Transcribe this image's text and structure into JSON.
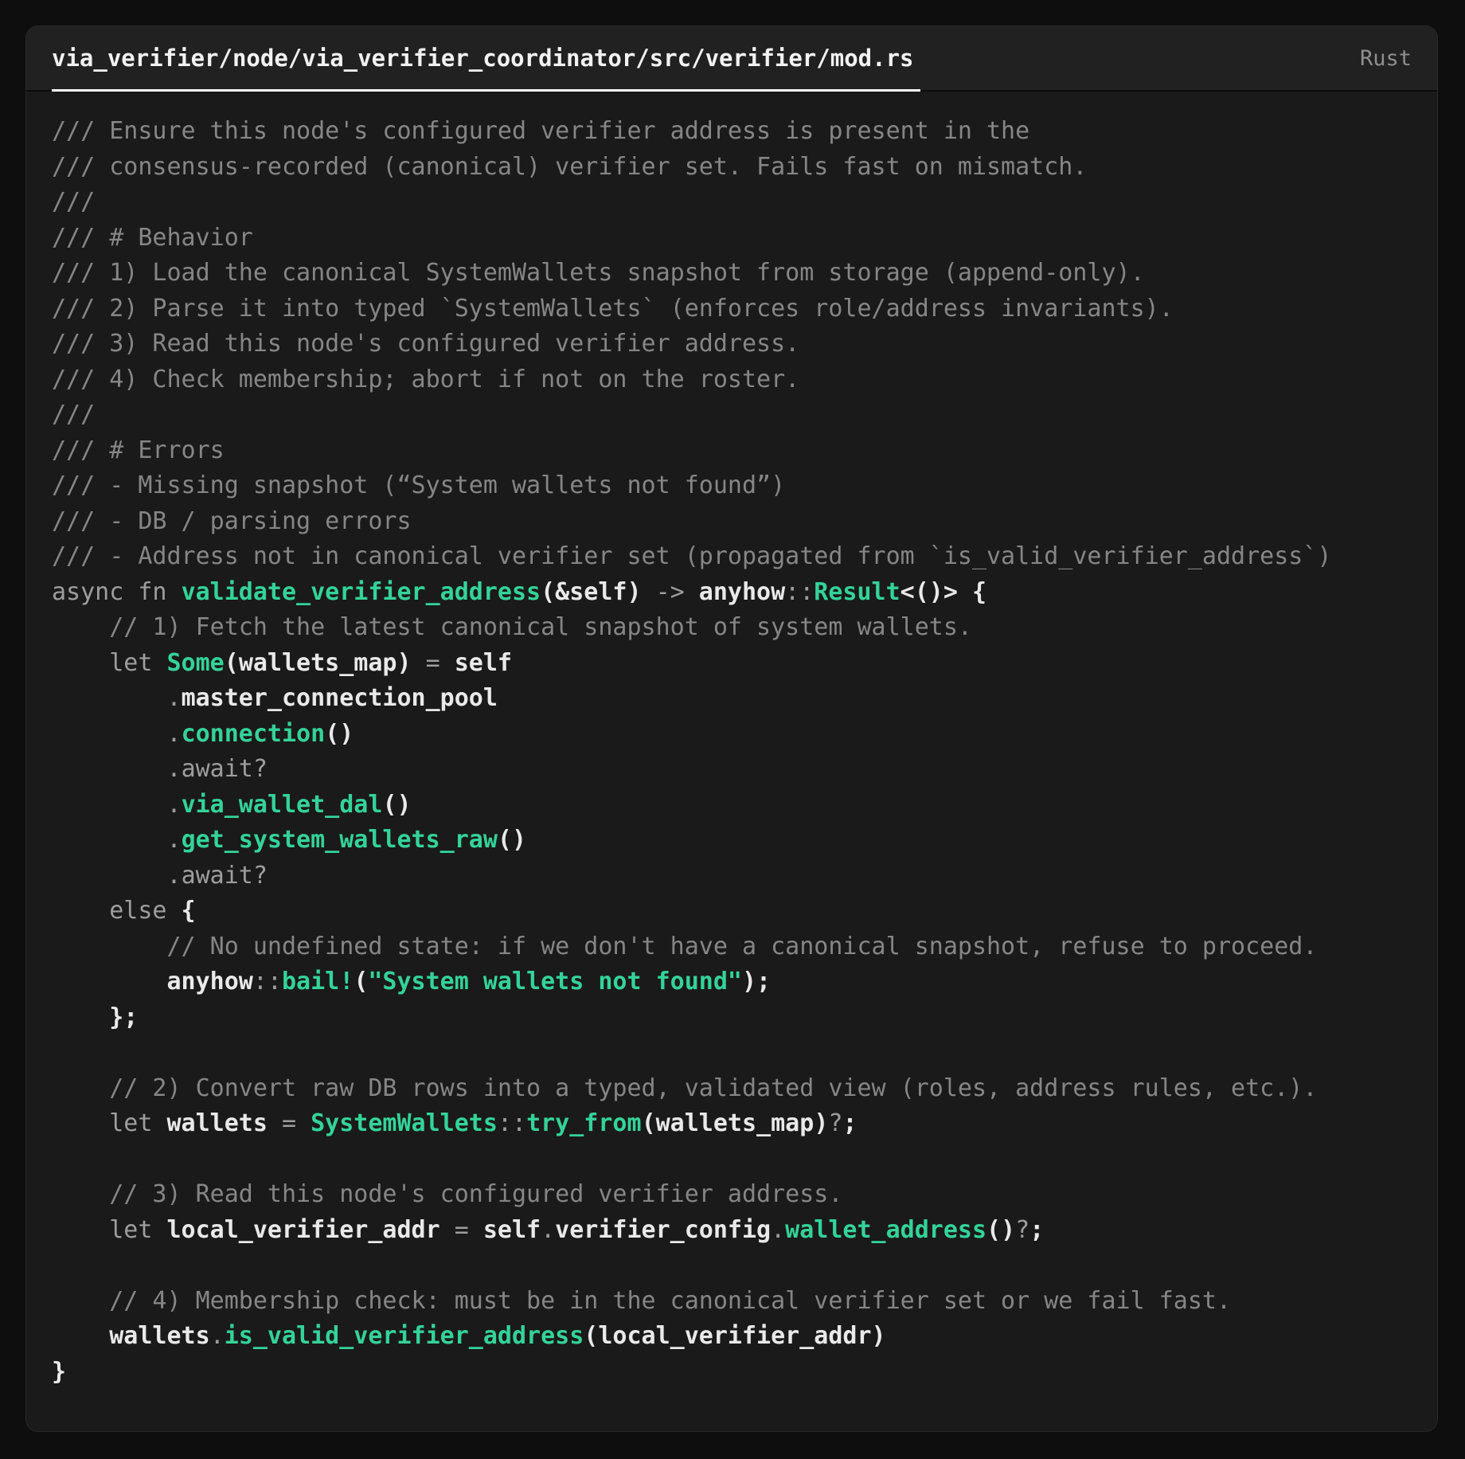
{
  "card": {
    "title": "via_verifier/node/via_verifier_coordinator/src/verifier/mod.rs",
    "language": "Rust"
  },
  "colors": {
    "page_bg": "#0e0e0e",
    "card_bg": "#1a1a1a",
    "header_bg": "#212121",
    "divider": "#0d0d0d",
    "title_color": "#f2f2f2",
    "title_underline": "#fafafa",
    "lang_color": "#8f8f8f",
    "comment": "#868686",
    "keyword": "#9e9e9e",
    "identifier": "#e9e9e9",
    "accent_green": "#34d399"
  },
  "code": {
    "lines": [
      [
        {
          "c": "cm",
          "t": "/// Ensure this node's configured verifier address is present in the"
        }
      ],
      [
        {
          "c": "cm",
          "t": "/// consensus-recorded (canonical) verifier set. Fails fast on mismatch."
        }
      ],
      [
        {
          "c": "cm",
          "t": "///"
        }
      ],
      [
        {
          "c": "cm",
          "t": "/// # Behavior"
        }
      ],
      [
        {
          "c": "cm",
          "t": "/// 1) Load the canonical SystemWallets snapshot from storage (append-only)."
        }
      ],
      [
        {
          "c": "cm",
          "t": "/// 2) Parse it into typed `SystemWallets` (enforces role/address invariants)."
        }
      ],
      [
        {
          "c": "cm",
          "t": "/// 3) Read this node's configured verifier address."
        }
      ],
      [
        {
          "c": "cm",
          "t": "/// 4) Check membership; abort if not on the roster."
        }
      ],
      [
        {
          "c": "cm",
          "t": "///"
        }
      ],
      [
        {
          "c": "cm",
          "t": "/// # Errors"
        }
      ],
      [
        {
          "c": "cm",
          "t": "/// - Missing snapshot (“System wallets not found”)"
        }
      ],
      [
        {
          "c": "cm",
          "t": "/// - DB / parsing errors"
        }
      ],
      [
        {
          "c": "cm",
          "t": "/// - Address not in canonical verifier set (propagated from `is_valid_verifier_address`)"
        }
      ],
      [
        {
          "c": "kw",
          "t": "async fn "
        },
        {
          "c": "fn",
          "t": "validate_verifier_address"
        },
        {
          "c": "pn",
          "t": "(&"
        },
        {
          "c": "id",
          "t": "self"
        },
        {
          "c": "pn",
          "t": ")"
        },
        {
          "c": "op",
          "t": " -> "
        },
        {
          "c": "id",
          "t": "anyhow"
        },
        {
          "c": "op",
          "t": "::"
        },
        {
          "c": "fn",
          "t": "Result"
        },
        {
          "c": "pn",
          "t": "<()> {"
        }
      ],
      [
        {
          "c": "cm",
          "t": "    // 1) Fetch the latest canonical snapshot of system wallets."
        }
      ],
      [
        {
          "c": "kw",
          "t": "    let "
        },
        {
          "c": "fn",
          "t": "Some"
        },
        {
          "c": "pn",
          "t": "("
        },
        {
          "c": "id",
          "t": "wallets_map"
        },
        {
          "c": "pn",
          "t": ")"
        },
        {
          "c": "op",
          "t": " = "
        },
        {
          "c": "id",
          "t": "self"
        }
      ],
      [
        {
          "c": "op",
          "t": "        ."
        },
        {
          "c": "id",
          "t": "master_connection_pool"
        }
      ],
      [
        {
          "c": "op",
          "t": "        ."
        },
        {
          "c": "fn",
          "t": "connection"
        },
        {
          "c": "pn",
          "t": "()"
        }
      ],
      [
        {
          "c": "op",
          "t": "        ."
        },
        {
          "c": "kw",
          "t": "await"
        },
        {
          "c": "op",
          "t": "?"
        }
      ],
      [
        {
          "c": "op",
          "t": "        ."
        },
        {
          "c": "fn",
          "t": "via_wallet_dal"
        },
        {
          "c": "pn",
          "t": "()"
        }
      ],
      [
        {
          "c": "op",
          "t": "        ."
        },
        {
          "c": "fn",
          "t": "get_system_wallets_raw"
        },
        {
          "c": "pn",
          "t": "()"
        }
      ],
      [
        {
          "c": "op",
          "t": "        ."
        },
        {
          "c": "kw",
          "t": "await"
        },
        {
          "c": "op",
          "t": "?"
        }
      ],
      [
        {
          "c": "kw",
          "t": "    else"
        },
        {
          "c": "pn",
          "t": " {"
        }
      ],
      [
        {
          "c": "cm",
          "t": "        // No undefined state: if we don't have a canonical snapshot, refuse to proceed."
        }
      ],
      [
        {
          "c": "id",
          "t": "        anyhow"
        },
        {
          "c": "op",
          "t": "::"
        },
        {
          "c": "fn",
          "t": "bail!"
        },
        {
          "c": "pn",
          "t": "("
        },
        {
          "c": "str",
          "t": "\"System wallets not found\""
        },
        {
          "c": "pn",
          "t": ");"
        }
      ],
      [
        {
          "c": "pn",
          "t": "    };"
        }
      ],
      [],
      [
        {
          "c": "cm",
          "t": "    // 2) Convert raw DB rows into a typed, validated view (roles, address rules, etc.)."
        }
      ],
      [
        {
          "c": "kw",
          "t": "    let "
        },
        {
          "c": "id",
          "t": "wallets"
        },
        {
          "c": "op",
          "t": " = "
        },
        {
          "c": "fn",
          "t": "SystemWallets"
        },
        {
          "c": "op",
          "t": "::"
        },
        {
          "c": "fn",
          "t": "try_from"
        },
        {
          "c": "pn",
          "t": "("
        },
        {
          "c": "id",
          "t": "wallets_map"
        },
        {
          "c": "pn",
          "t": ")"
        },
        {
          "c": "op",
          "t": "?"
        },
        {
          "c": "pn",
          "t": ";"
        }
      ],
      [],
      [
        {
          "c": "cm",
          "t": "    // 3) Read this node's configured verifier address."
        }
      ],
      [
        {
          "c": "kw",
          "t": "    let "
        },
        {
          "c": "id",
          "t": "local_verifier_addr"
        },
        {
          "c": "op",
          "t": " = "
        },
        {
          "c": "id",
          "t": "self"
        },
        {
          "c": "op",
          "t": "."
        },
        {
          "c": "id",
          "t": "verifier_config"
        },
        {
          "c": "op",
          "t": "."
        },
        {
          "c": "fn",
          "t": "wallet_address"
        },
        {
          "c": "pn",
          "t": "()"
        },
        {
          "c": "op",
          "t": "?"
        },
        {
          "c": "pn",
          "t": ";"
        }
      ],
      [],
      [
        {
          "c": "cm",
          "t": "    // 4) Membership check: must be in the canonical verifier set or we fail fast."
        }
      ],
      [
        {
          "c": "id",
          "t": "    wallets"
        },
        {
          "c": "op",
          "t": "."
        },
        {
          "c": "fn",
          "t": "is_valid_verifier_address"
        },
        {
          "c": "pn",
          "t": "("
        },
        {
          "c": "id",
          "t": "local_verifier_addr"
        },
        {
          "c": "pn",
          "t": ")"
        }
      ],
      [
        {
          "c": "pn",
          "t": "}"
        }
      ]
    ]
  }
}
